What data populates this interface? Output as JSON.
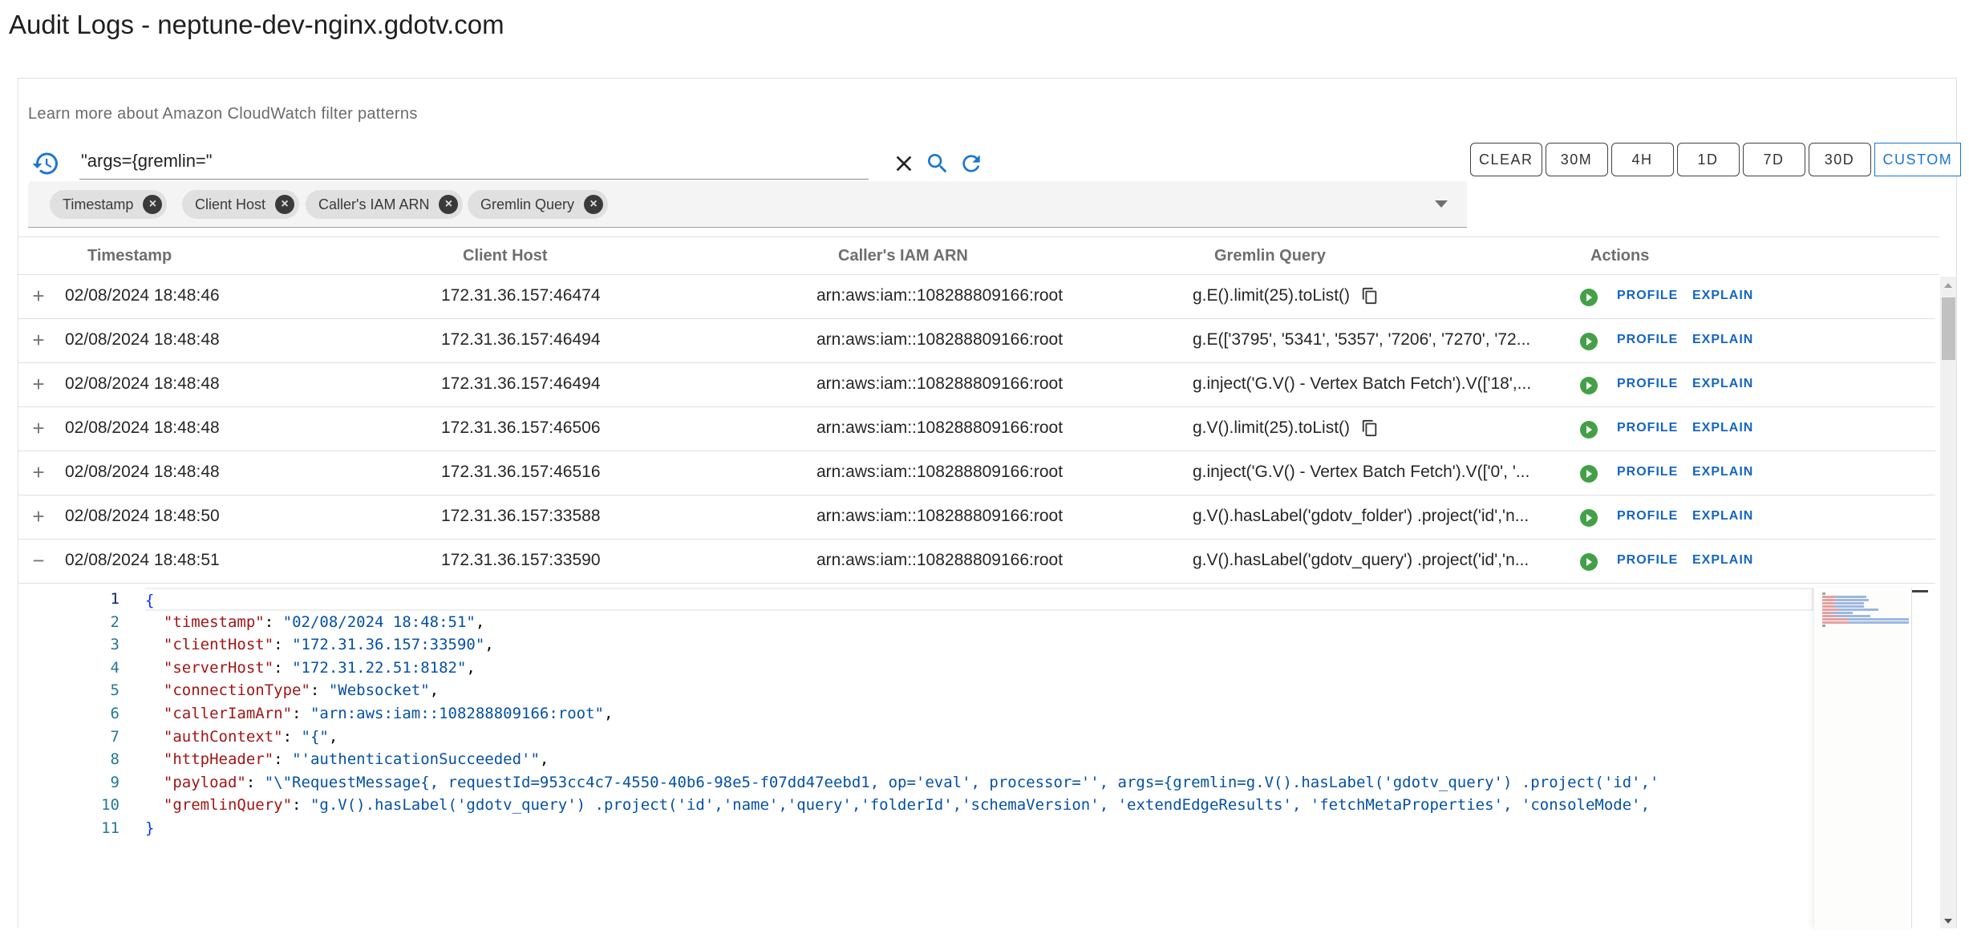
{
  "page": {
    "title": "Audit Logs - neptune-dev-nginx.gdotv.com"
  },
  "filter": {
    "learn_more": "Learn more about Amazon CloudWatch filter patterns",
    "search_value": "\"args={gremlin=\"",
    "icons": {
      "history": "history-icon",
      "clear": "close-icon",
      "search": "search-icon",
      "refresh": "refresh-icon"
    },
    "columns_chips": [
      "Timestamp",
      "Client Host",
      "Caller's IAM ARN",
      "Gremlin Query"
    ],
    "range_buttons": [
      "CLEAR",
      "30M",
      "4H",
      "1D",
      "7D",
      "30D",
      "CUSTOM"
    ],
    "active_range": "CUSTOM"
  },
  "table": {
    "headers": [
      "Timestamp",
      "Client Host",
      "Caller's IAM ARN",
      "Gremlin Query",
      "Actions"
    ],
    "action_labels": {
      "profile": "PROFILE",
      "explain": "EXPLAIN"
    },
    "rows": [
      {
        "expanded": false,
        "timestamp": "02/08/2024 18:48:46",
        "client_host": "172.31.36.157:46474",
        "caller_arn": "arn:aws:iam::108288809166:root",
        "query": "g.E().limit(25).toList()",
        "copy_icon": true
      },
      {
        "expanded": false,
        "timestamp": "02/08/2024 18:48:48",
        "client_host": "172.31.36.157:46494",
        "caller_arn": "arn:aws:iam::108288809166:root",
        "query": "g.E(['3795', '5341', '5357', '7206', '7270', '72...",
        "copy_icon": false
      },
      {
        "expanded": false,
        "timestamp": "02/08/2024 18:48:48",
        "client_host": "172.31.36.157:46494",
        "caller_arn": "arn:aws:iam::108288809166:root",
        "query": "g.inject('G.V() - Vertex Batch Fetch').V(['18',...",
        "copy_icon": false
      },
      {
        "expanded": false,
        "timestamp": "02/08/2024 18:48:48",
        "client_host": "172.31.36.157:46506",
        "caller_arn": "arn:aws:iam::108288809166:root",
        "query": "g.V().limit(25).toList()",
        "copy_icon": true
      },
      {
        "expanded": false,
        "timestamp": "02/08/2024 18:48:48",
        "client_host": "172.31.36.157:46516",
        "caller_arn": "arn:aws:iam::108288809166:root",
        "query": "g.inject('G.V() - Vertex Batch Fetch').V(['0', '...",
        "copy_icon": false
      },
      {
        "expanded": false,
        "timestamp": "02/08/2024 18:48:50",
        "client_host": "172.31.36.157:33588",
        "caller_arn": "arn:aws:iam::108288809166:root",
        "query": "g.V().hasLabel('gdotv_folder') .project('id','n...",
        "copy_icon": false
      },
      {
        "expanded": true,
        "timestamp": "02/08/2024 18:48:51",
        "client_host": "172.31.36.157:33590",
        "caller_arn": "arn:aws:iam::108288809166:root",
        "query": "g.V().hasLabel('gdotv_query') .project('id','n...",
        "copy_icon": false
      }
    ]
  },
  "detail_json": {
    "line_numbers": [
      "1",
      "2",
      "3",
      "4",
      "5",
      "6",
      "7",
      "8",
      "9",
      "10",
      "11"
    ],
    "open_brace": "{",
    "close_brace": "}",
    "entries": [
      {
        "key": "\"timestamp\"",
        "value": "\"02/08/2024 18:48:51\""
      },
      {
        "key": "\"clientHost\"",
        "value": "\"172.31.36.157:33590\""
      },
      {
        "key": "\"serverHost\"",
        "value": "\"172.31.22.51:8182\""
      },
      {
        "key": "\"connectionType\"",
        "value": "\"Websocket\""
      },
      {
        "key": "\"callerIamArn\"",
        "value": "\"arn:aws:iam::108288809166:root\""
      },
      {
        "key": "\"authContext\"",
        "value": "\"{\""
      },
      {
        "key": "\"httpHeader\"",
        "value": "\"'authenticationSucceeded'\""
      },
      {
        "key": "\"payload\"",
        "value": "\"\\\"RequestMessage{, requestId=953cc4c7-4550-40b6-98e5-f07dd47eebd1, op='eval', processor='', args={gremlin=g.V().hasLabel('gdotv_query') .project('id','"
      },
      {
        "key": "\"gremlinQuery\"",
        "value": "\"g.V().hasLabel('gdotv_query') .project('id','name','query','folderId','schemaVersion', 'extendEdgeResults', 'fetchMetaProperties', 'consoleMode',"
      }
    ]
  },
  "colors": {
    "accent": "#1976d2",
    "link": "#1565c0",
    "play": "#43a047",
    "json_key": "#a31515",
    "json_string": "#0451a5",
    "line_number": "#237893"
  }
}
